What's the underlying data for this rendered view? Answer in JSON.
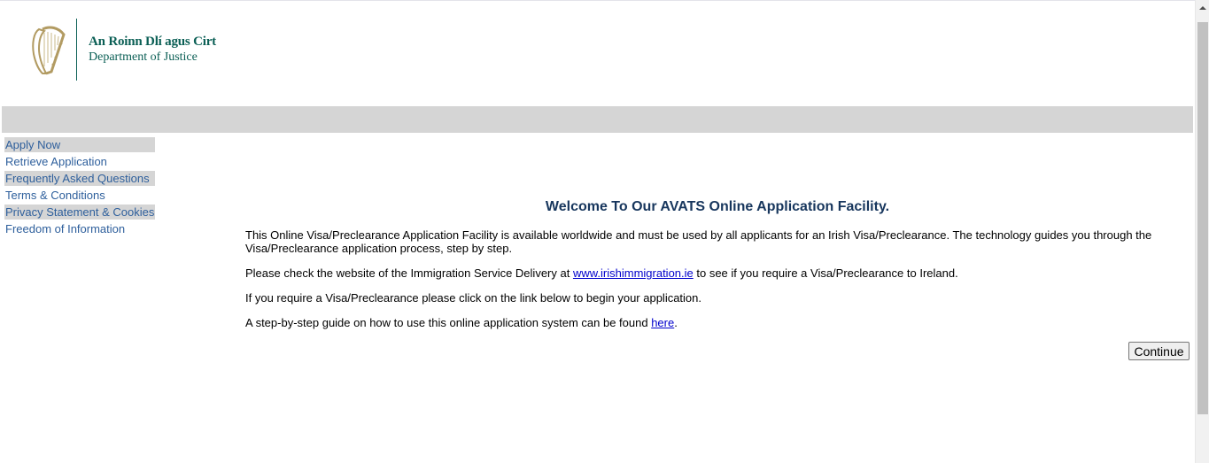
{
  "header": {
    "logo_irish": "An Roinn Dlí agus Cirt",
    "logo_english": "Department of Justice",
    "logo_icon": "harp-icon",
    "brand_color": "#0b5f55"
  },
  "sidebar": {
    "items": [
      {
        "label": "Apply Now",
        "shaded": true
      },
      {
        "label": "Retrieve Application",
        "shaded": false
      },
      {
        "label": "Frequently Asked Questions",
        "shaded": true
      },
      {
        "label": "Terms & Conditions",
        "shaded": false
      },
      {
        "label": "Privacy Statement & Cookies",
        "shaded": true
      },
      {
        "label": "Freedom of Information",
        "shaded": false
      }
    ]
  },
  "main": {
    "title": "Welcome To Our AVATS Online Application Facility.",
    "para1": "This Online Visa/Preclearance Application Facility is available worldwide and must be used by all applicants for an Irish Visa/Preclearance. The technology guides you through the Visa/Preclearance application process, step by step.",
    "para2_before": "Please check the website of the Immigration Service Delivery at ",
    "para2_link": "www.irishimmigration.ie",
    "para2_after": " to see if you require a Visa/Preclearance to Ireland.",
    "para3": "If you require a Visa/Preclearance please click on the link below to begin your application.",
    "para4_before": "A step-by-step guide on how to use this online application system can be found ",
    "para4_link": "here",
    "para4_after": ".",
    "continue_label": "Continue"
  }
}
